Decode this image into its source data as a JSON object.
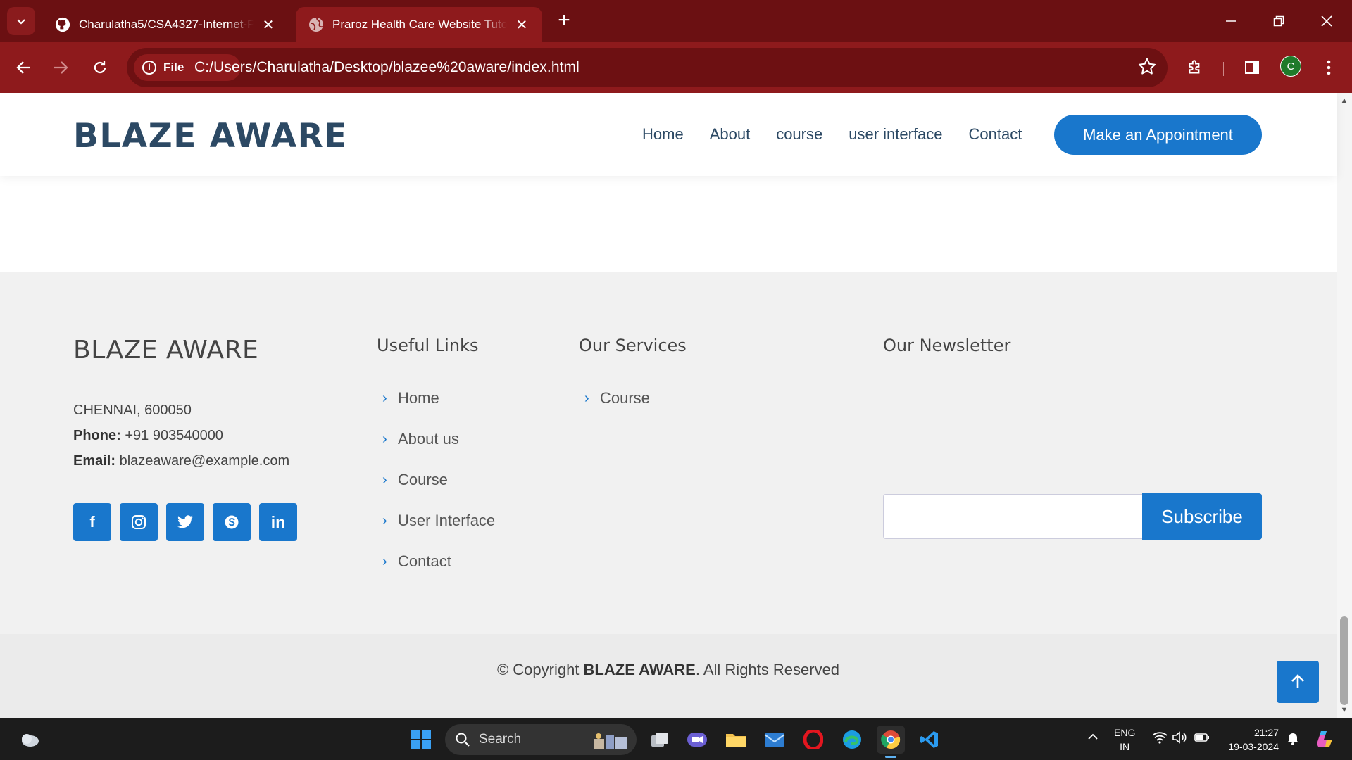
{
  "browser": {
    "tabs": [
      {
        "title": "Charulatha5/CSA4327-Internet-Programming",
        "icon": "github-icon",
        "active": false
      },
      {
        "title": "Praroz Health Care Website Tutorial",
        "icon": "globe-icon",
        "active": true
      }
    ],
    "site_chip": "File",
    "url": "C:/Users/Charulatha/Desktop/blazee%20aware/index.html",
    "profile_initial": "C",
    "accent_color": "#8e1a1c"
  },
  "header": {
    "logo": "BLAZE AWARE",
    "nav": [
      "Home",
      "About",
      "course",
      "user interface",
      "Contact"
    ],
    "cta": "Make an Appointment"
  },
  "footer": {
    "brand": "BLAZE AWARE",
    "address": "CHENNAI, 600050",
    "phone_label": "Phone:",
    "phone": "+91 903540000",
    "email_label": "Email:",
    "email": "blazeaware@example.com",
    "socials": [
      "facebook-icon",
      "instagram-icon",
      "twitter-icon",
      "skype-icon",
      "linkedin-icon"
    ],
    "useful_links_title": "Useful Links",
    "useful_links": [
      "Home",
      "About us",
      "Course",
      "User Interface",
      "Contact"
    ],
    "services_title": "Our Services",
    "services": [
      "Course"
    ],
    "newsletter_title": "Our Newsletter",
    "newsletter_input_value": "",
    "subscribe_label": "Subscribe",
    "copyright_prefix": "© Copyright",
    "copyright_brand": "BLAZE AWARE",
    "copyright_suffix": ". All Rights Reserved",
    "brand_color": "#1977cc"
  },
  "taskbar": {
    "search_placeholder": "Search",
    "lang_line1": "ENG",
    "lang_line2": "IN",
    "time": "21:27",
    "date": "19-03-2024"
  }
}
